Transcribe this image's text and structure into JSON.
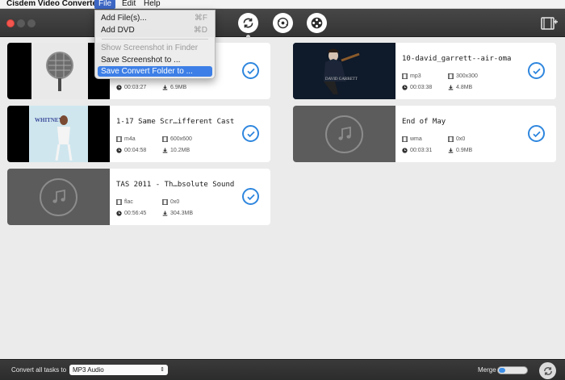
{
  "menubar": {
    "app_name": "Cisdem Video Converter",
    "menus": [
      "File",
      "Edit",
      "Help"
    ],
    "active_menu": "File"
  },
  "file_menu": {
    "items": [
      {
        "label": "Add File(s)...",
        "shortcut": "⌘F",
        "state": "normal"
      },
      {
        "label": "Add DVD",
        "shortcut": "⌘D",
        "state": "normal"
      },
      {
        "label": "Show Screenshot in Finder",
        "shortcut": "",
        "state": "disabled"
      },
      {
        "label": "Save Screenshot to ...",
        "shortcut": "",
        "state": "normal"
      },
      {
        "label": "Save Convert Folder to ...",
        "shortcut": "",
        "state": "selected"
      }
    ]
  },
  "toolbar": {
    "modes": [
      "convert-mode",
      "rip-dvd-mode",
      "compress-video-mode"
    ],
    "active_mode": "convert-mode"
  },
  "tasks": [
    {
      "title": "",
      "format": "",
      "resolution": "",
      "duration": "00:03:27",
      "size": "6.9MB",
      "thumb": "cover-microphone",
      "checked": true
    },
    {
      "title": "10-david_garrett--air-oma",
      "format": "mp3",
      "resolution": "300x300",
      "duration": "00:03:38",
      "size": "4.8MB",
      "thumb": "cover-violinist",
      "checked": true
    },
    {
      "title": "1-17 Same Scr…ifferent Cast",
      "format": "m4a",
      "resolution": "600x600",
      "duration": "00:04:58",
      "size": "10.2MB",
      "thumb": "cover-whitney",
      "checked": true
    },
    {
      "title": "End of May",
      "format": "wma",
      "resolution": "0x0",
      "duration": "00:03:31",
      "size": "0.9MB",
      "thumb": "music-note",
      "checked": true
    },
    {
      "title": "TAS 2011 - Th…bsolute Sound",
      "format": "flac",
      "resolution": "0x0",
      "duration": "00:56:45",
      "size": "304.3MB",
      "thumb": "music-note",
      "checked": true
    }
  ],
  "bottombar": {
    "convert_all_label": "Convert all tasks to",
    "format_value": "MP3 Audio",
    "merge_label": "Merge",
    "merge_on": true
  },
  "colors": {
    "accent": "#2e86de",
    "menu_highlight": "#3d7fe6",
    "toolbar": "#3c3c3c",
    "close_light": "#f2564e"
  }
}
